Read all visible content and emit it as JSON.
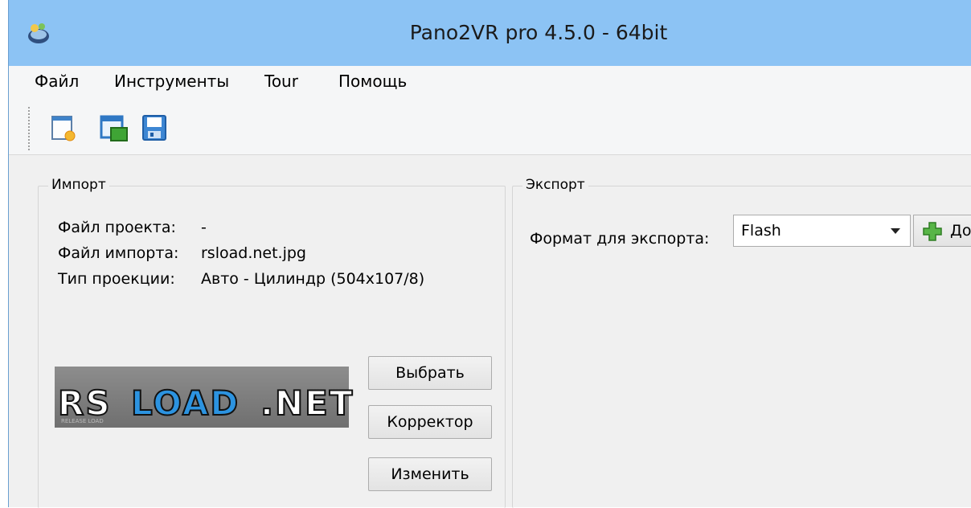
{
  "window": {
    "title": "Pano2VR pro 4.5.0 - 64bit"
  },
  "menu": {
    "items": [
      "Файл",
      "Инструменты",
      "Tour",
      "Помощь"
    ]
  },
  "toolbar": {
    "buttons": [
      "new-project-icon",
      "open-project-icon",
      "save-icon"
    ]
  },
  "import": {
    "title": "Импорт",
    "project_file_label": "Файл проекта:",
    "project_file_value": "-",
    "import_file_label": "Файл импорта:",
    "import_file_value": "rsload.net.jpg",
    "projection_label": "Тип проекции:",
    "projection_value": "Авто - Цилиндр (504x107/8)",
    "preview": {
      "logo_rs": "RS",
      "logo_load": "LOAD",
      "logo_net": ".NET",
      "logo_tagline": "RELEASE LOAD"
    },
    "select_button": "Выбрать",
    "corrector_button": "Корректор",
    "change_button": "Изменить"
  },
  "export": {
    "title": "Экспорт",
    "format_label": "Формат для экспорта:",
    "format_value": "Flash",
    "add_button_label": "До"
  },
  "colors": {
    "titlebar": "#8cc3f4",
    "accent_blue": "#2c93e0",
    "add_icon_green": "#58b547"
  }
}
